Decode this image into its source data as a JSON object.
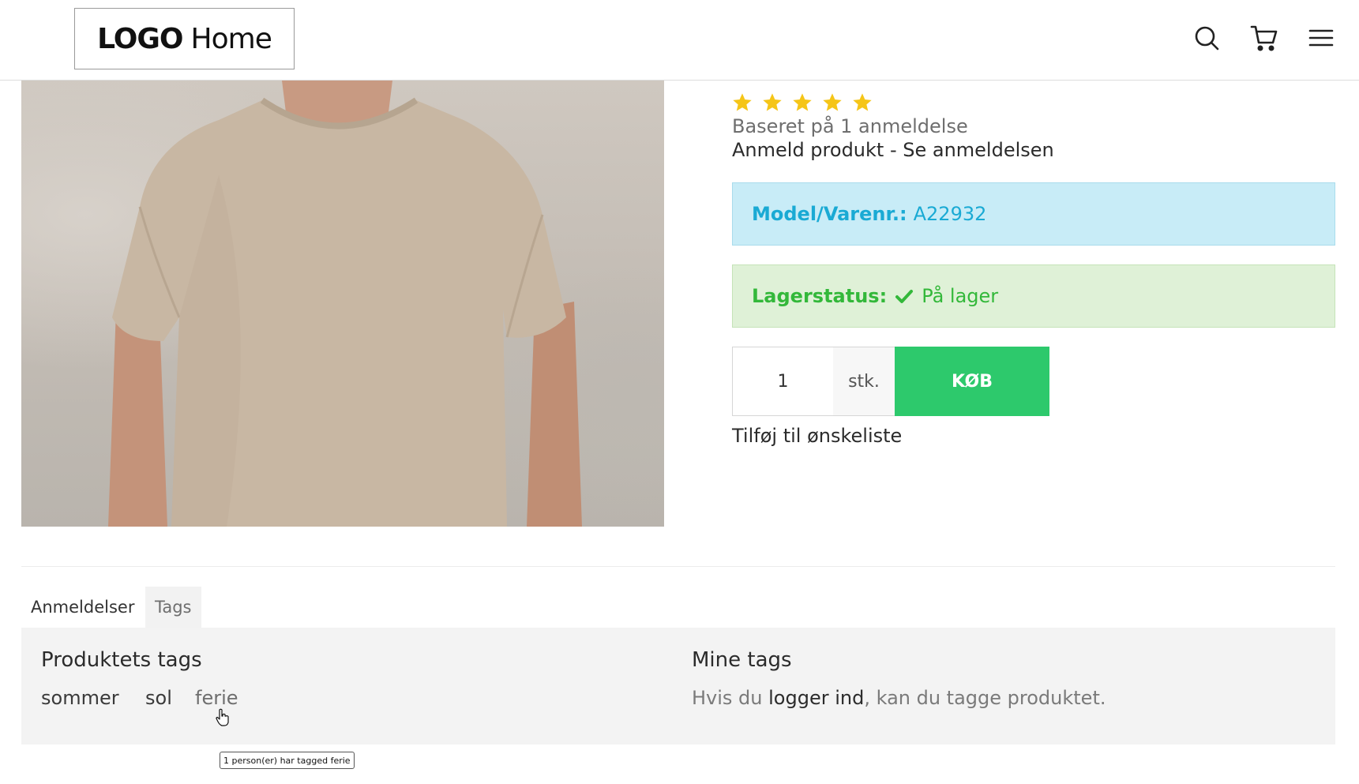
{
  "header": {
    "logo_bold": "LOGO",
    "logo_thin": "Home",
    "icons": [
      "search-icon",
      "cart-icon",
      "menu-icon"
    ]
  },
  "product": {
    "rating": 5,
    "rating_max": 5,
    "review_basis": "Baseret på 1 anmeldelse",
    "review_link": "Anmeld produkt - Se anmeldelsen",
    "model_label": "Model/Varenr.:",
    "model_value": "A22932",
    "stock_label": "Lagerstatus:",
    "stock_value": "På lager",
    "quantity": "1",
    "unit": "stk.",
    "buy_label": "KØB",
    "wishlist_label": "Tilføj til ønskeliste"
  },
  "tabs": [
    {
      "label": "Anmeldelser",
      "active": false
    },
    {
      "label": "Tags",
      "active": true
    }
  ],
  "tags_panel": {
    "product_tags_title": "Produktets tags",
    "tags": [
      "sommer",
      "sol",
      "ferie"
    ],
    "my_tags_title": "Mine tags",
    "my_tags_prefix": "Hvis du ",
    "my_tags_login": "logger ind",
    "my_tags_suffix": ", kan du tagge produktet."
  },
  "tooltip": "1 person(er) har tagged ferie",
  "colors": {
    "star": "#f5c518",
    "model_bg": "#c8ecf7",
    "model_text": "#1aaad4",
    "stock_bg": "#dff1d7",
    "stock_text": "#33b83a",
    "buy_button": "#2dc96c"
  }
}
